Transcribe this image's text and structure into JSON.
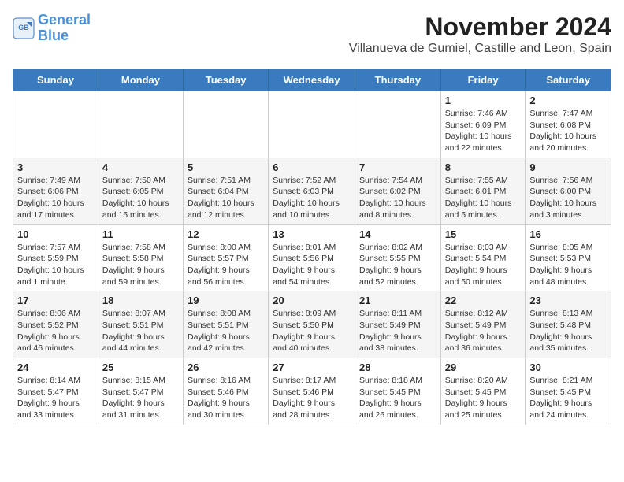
{
  "logo": {
    "line1": "General",
    "line2": "Blue"
  },
  "title": "November 2024",
  "subtitle": "Villanueva de Gumiel, Castille and Leon, Spain",
  "weekdays": [
    "Sunday",
    "Monday",
    "Tuesday",
    "Wednesday",
    "Thursday",
    "Friday",
    "Saturday"
  ],
  "weeks": [
    [
      {
        "day": "",
        "info": ""
      },
      {
        "day": "",
        "info": ""
      },
      {
        "day": "",
        "info": ""
      },
      {
        "day": "",
        "info": ""
      },
      {
        "day": "",
        "info": ""
      },
      {
        "day": "1",
        "info": "Sunrise: 7:46 AM\nSunset: 6:09 PM\nDaylight: 10 hours and 22 minutes."
      },
      {
        "day": "2",
        "info": "Sunrise: 7:47 AM\nSunset: 6:08 PM\nDaylight: 10 hours and 20 minutes."
      }
    ],
    [
      {
        "day": "3",
        "info": "Sunrise: 7:49 AM\nSunset: 6:06 PM\nDaylight: 10 hours and 17 minutes."
      },
      {
        "day": "4",
        "info": "Sunrise: 7:50 AM\nSunset: 6:05 PM\nDaylight: 10 hours and 15 minutes."
      },
      {
        "day": "5",
        "info": "Sunrise: 7:51 AM\nSunset: 6:04 PM\nDaylight: 10 hours and 12 minutes."
      },
      {
        "day": "6",
        "info": "Sunrise: 7:52 AM\nSunset: 6:03 PM\nDaylight: 10 hours and 10 minutes."
      },
      {
        "day": "7",
        "info": "Sunrise: 7:54 AM\nSunset: 6:02 PM\nDaylight: 10 hours and 8 minutes."
      },
      {
        "day": "8",
        "info": "Sunrise: 7:55 AM\nSunset: 6:01 PM\nDaylight: 10 hours and 5 minutes."
      },
      {
        "day": "9",
        "info": "Sunrise: 7:56 AM\nSunset: 6:00 PM\nDaylight: 10 hours and 3 minutes."
      }
    ],
    [
      {
        "day": "10",
        "info": "Sunrise: 7:57 AM\nSunset: 5:59 PM\nDaylight: 10 hours and 1 minute."
      },
      {
        "day": "11",
        "info": "Sunrise: 7:58 AM\nSunset: 5:58 PM\nDaylight: 9 hours and 59 minutes."
      },
      {
        "day": "12",
        "info": "Sunrise: 8:00 AM\nSunset: 5:57 PM\nDaylight: 9 hours and 56 minutes."
      },
      {
        "day": "13",
        "info": "Sunrise: 8:01 AM\nSunset: 5:56 PM\nDaylight: 9 hours and 54 minutes."
      },
      {
        "day": "14",
        "info": "Sunrise: 8:02 AM\nSunset: 5:55 PM\nDaylight: 9 hours and 52 minutes."
      },
      {
        "day": "15",
        "info": "Sunrise: 8:03 AM\nSunset: 5:54 PM\nDaylight: 9 hours and 50 minutes."
      },
      {
        "day": "16",
        "info": "Sunrise: 8:05 AM\nSunset: 5:53 PM\nDaylight: 9 hours and 48 minutes."
      }
    ],
    [
      {
        "day": "17",
        "info": "Sunrise: 8:06 AM\nSunset: 5:52 PM\nDaylight: 9 hours and 46 minutes."
      },
      {
        "day": "18",
        "info": "Sunrise: 8:07 AM\nSunset: 5:51 PM\nDaylight: 9 hours and 44 minutes."
      },
      {
        "day": "19",
        "info": "Sunrise: 8:08 AM\nSunset: 5:51 PM\nDaylight: 9 hours and 42 minutes."
      },
      {
        "day": "20",
        "info": "Sunrise: 8:09 AM\nSunset: 5:50 PM\nDaylight: 9 hours and 40 minutes."
      },
      {
        "day": "21",
        "info": "Sunrise: 8:11 AM\nSunset: 5:49 PM\nDaylight: 9 hours and 38 minutes."
      },
      {
        "day": "22",
        "info": "Sunrise: 8:12 AM\nSunset: 5:49 PM\nDaylight: 9 hours and 36 minutes."
      },
      {
        "day": "23",
        "info": "Sunrise: 8:13 AM\nSunset: 5:48 PM\nDaylight: 9 hours and 35 minutes."
      }
    ],
    [
      {
        "day": "24",
        "info": "Sunrise: 8:14 AM\nSunset: 5:47 PM\nDaylight: 9 hours and 33 minutes."
      },
      {
        "day": "25",
        "info": "Sunrise: 8:15 AM\nSunset: 5:47 PM\nDaylight: 9 hours and 31 minutes."
      },
      {
        "day": "26",
        "info": "Sunrise: 8:16 AM\nSunset: 5:46 PM\nDaylight: 9 hours and 30 minutes."
      },
      {
        "day": "27",
        "info": "Sunrise: 8:17 AM\nSunset: 5:46 PM\nDaylight: 9 hours and 28 minutes."
      },
      {
        "day": "28",
        "info": "Sunrise: 8:18 AM\nSunset: 5:45 PM\nDaylight: 9 hours and 26 minutes."
      },
      {
        "day": "29",
        "info": "Sunrise: 8:20 AM\nSunset: 5:45 PM\nDaylight: 9 hours and 25 minutes."
      },
      {
        "day": "30",
        "info": "Sunrise: 8:21 AM\nSunset: 5:45 PM\nDaylight: 9 hours and 24 minutes."
      }
    ]
  ]
}
